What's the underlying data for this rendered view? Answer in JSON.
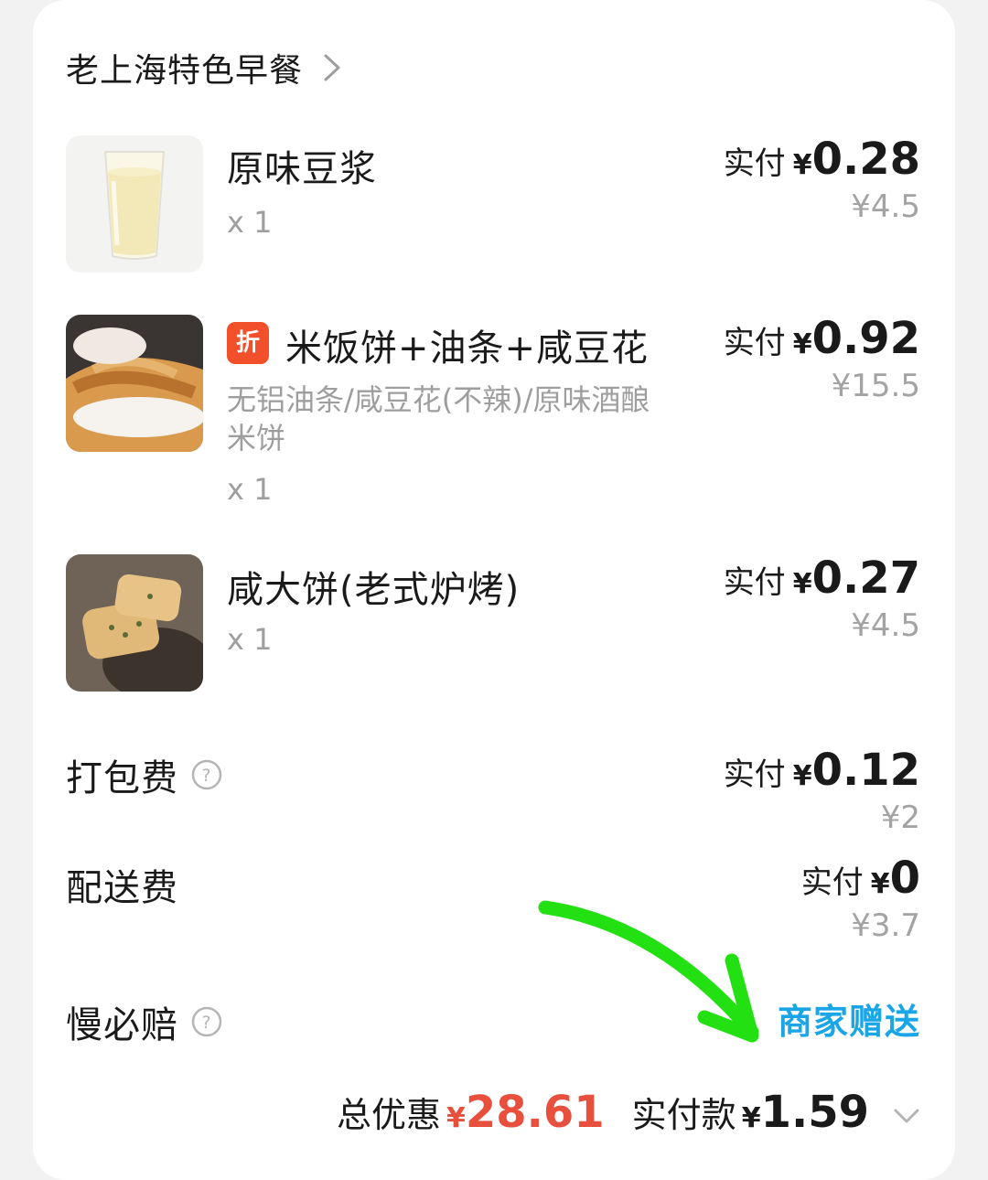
{
  "store": {
    "name": "老上海特色早餐"
  },
  "items": [
    {
      "name": "原味豆浆",
      "spec": "",
      "qty": "x 1",
      "paid_label": "实付",
      "yen": "¥",
      "paid_amount": "0.28",
      "original_price": "¥4.5",
      "badge": ""
    },
    {
      "name": "米饭饼+油条+咸豆花",
      "spec": "无铝油条/咸豆花(不辣)/原味酒酿米饼",
      "qty": "x 1",
      "paid_label": "实付",
      "yen": "¥",
      "paid_amount": "0.92",
      "original_price": "¥15.5",
      "badge": "折"
    },
    {
      "name": "咸大饼(老式炉烤)",
      "spec": "",
      "qty": "x 1",
      "paid_label": "实付",
      "yen": "¥",
      "paid_amount": "0.27",
      "original_price": "¥4.5",
      "badge": ""
    }
  ],
  "fees": {
    "packing": {
      "label": "打包费",
      "paid_label": "实付",
      "yen": "¥",
      "paid_amount": "0.12",
      "original_price": "¥2"
    },
    "delivery": {
      "label": "配送费",
      "paid_label": "实付",
      "yen": "¥",
      "paid_amount": "0",
      "original_price": "¥3.7"
    },
    "late_compensation": {
      "label": "慢必赔",
      "value": "商家赠送"
    }
  },
  "footer": {
    "total_discount_label": "总优惠",
    "total_discount_yen": "¥",
    "total_discount_amount": "28.61",
    "paid_total_label": "实付款",
    "paid_total_yen": "¥",
    "paid_total_amount": "1.59"
  },
  "icons": {
    "store_chevron": "chevron-right-icon",
    "help": "question-circle-icon",
    "expand": "chevron-down-icon"
  },
  "colors": {
    "discount_red": "#e84f3d",
    "badge_red": "#f2502b",
    "gift_blue": "#1aa6e6",
    "annotation_green": "#22e012"
  }
}
